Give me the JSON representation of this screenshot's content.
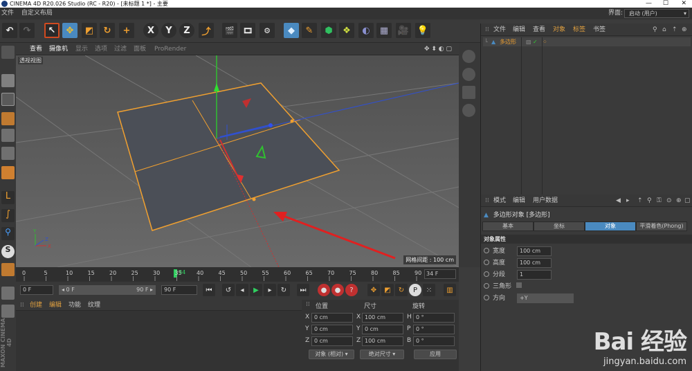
{
  "titlebar": {
    "title": "CINEMA 4D R20.026 Studio (RC - R20) - [未标题 1 *] - 主要",
    "minimize": "—",
    "maximize": "☐",
    "close": "✕"
  },
  "menubar": {
    "items": [
      "文件",
      "自定义布局"
    ],
    "layout_label": "界面:",
    "layout_value": "启动 (用户)"
  },
  "viewport": {
    "menu": [
      "查看",
      "摄像机",
      "显示",
      "选项",
      "过滤",
      "面板",
      "ProRender"
    ],
    "label": "透视视图",
    "grid_info": "网格间距 : 100 cm"
  },
  "timeline": {
    "ticks": [
      "0",
      "5",
      "10",
      "15",
      "20",
      "25",
      "30",
      "35",
      "40",
      "45",
      "50",
      "55",
      "60",
      "65",
      "70",
      "75",
      "80",
      "85",
      "90"
    ],
    "current_frame": "34",
    "end_frame": "34 F"
  },
  "transport": {
    "start": "0 F",
    "current": "◂ 0 F",
    "preview_end": "90 F ▸",
    "end": "90 F"
  },
  "material": {
    "tabs": [
      "创建",
      "编辑",
      "功能",
      "纹理"
    ]
  },
  "coordinates": {
    "headers": [
      "位置",
      "尺寸",
      "旋转"
    ],
    "rows": [
      {
        "axis": "X",
        "pos": "0 cm",
        "size": "100 cm",
        "rot_axis": "H",
        "rot": "0 °"
      },
      {
        "axis": "Y",
        "pos": "0 cm",
        "size": "0 cm",
        "rot_axis": "P",
        "rot": "0 °"
      },
      {
        "axis": "Z",
        "pos": "0 cm",
        "size": "100 cm",
        "rot_axis": "B",
        "rot": "0 °"
      }
    ],
    "mode": "对象 (相对)",
    "size_mode": "绝对尺寸",
    "apply": "应用"
  },
  "object_manager": {
    "menu": [
      "文件",
      "编辑",
      "查看",
      "对象",
      "标签",
      "书签"
    ],
    "object_name": "多边形"
  },
  "attributes": {
    "menu": [
      "模式",
      "编辑",
      "用户数据"
    ],
    "title": "多边形对象 [多边形]",
    "tabs": [
      "基本",
      "坐标",
      "对象",
      "平滑着色(Phong)"
    ],
    "active_tab": "对象",
    "section": "对象属性",
    "props": [
      {
        "label": "宽度",
        "value": "100 cm"
      },
      {
        "label": "高度",
        "value": "100 cm"
      },
      {
        "label": "分段",
        "value": "1"
      },
      {
        "label": "三角形",
        "value": ""
      },
      {
        "label": "方向",
        "value": "+Y"
      }
    ]
  },
  "branding": {
    "maxon": "MAXON CINEMA 4D",
    "watermark_main": "Bai 经验",
    "watermark_sub": "jingyan.baidu.com"
  },
  "colors": {
    "accent_orange": "#f0a030",
    "selection_blue": "#4a8ac0",
    "axis_x": "#d03030",
    "axis_y": "#30c030",
    "axis_z": "#3050d0"
  }
}
